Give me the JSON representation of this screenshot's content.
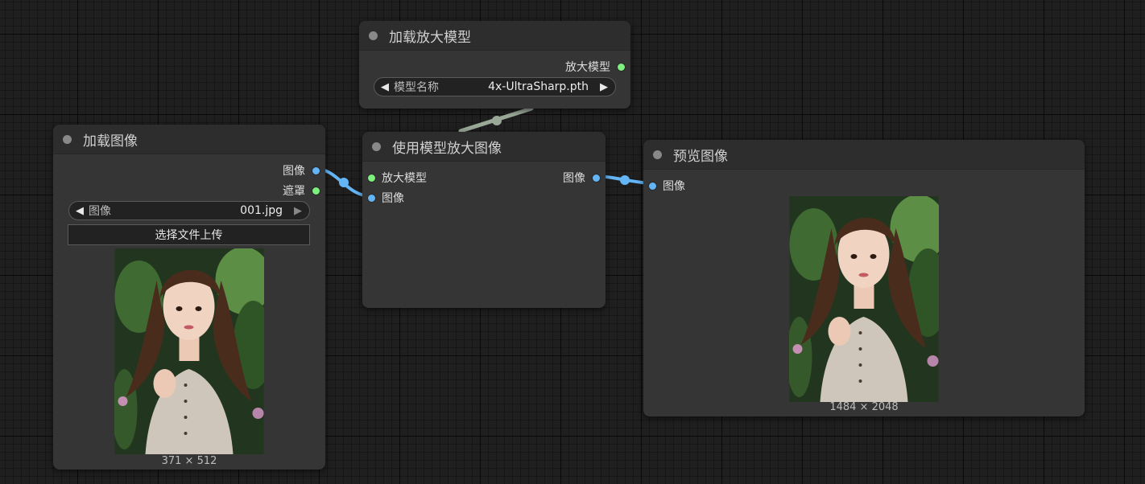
{
  "nodes": {
    "upscale_model_loader": {
      "title": "加载放大模型",
      "output_label": "放大模型",
      "combo_label": "模型名称",
      "combo_value": "4x-UltraSharp.pth"
    },
    "load_image": {
      "title": "加载图像",
      "output_image_label": "图像",
      "output_mask_label": "遮罩",
      "combo_label": "图像",
      "combo_value": "001.jpg",
      "upload_label": "选择文件上传",
      "image_dims": "371 × 512"
    },
    "upscale_with_model": {
      "title": "使用模型放大图像",
      "input_model_label": "放大模型",
      "input_image_label": "图像",
      "output_label": "图像"
    },
    "preview_image": {
      "title": "预览图像",
      "input_label": "图像",
      "image_dims": "1484 × 2048"
    }
  },
  "colors": {
    "canvas": "#1f1f1f",
    "node_body": "#353535",
    "node_title": "#2d2d2d",
    "slot_model": "#7ef07e",
    "slot_image": "#64b5f6",
    "link_model": "#9aa898",
    "link_image": "#64b5f6"
  }
}
